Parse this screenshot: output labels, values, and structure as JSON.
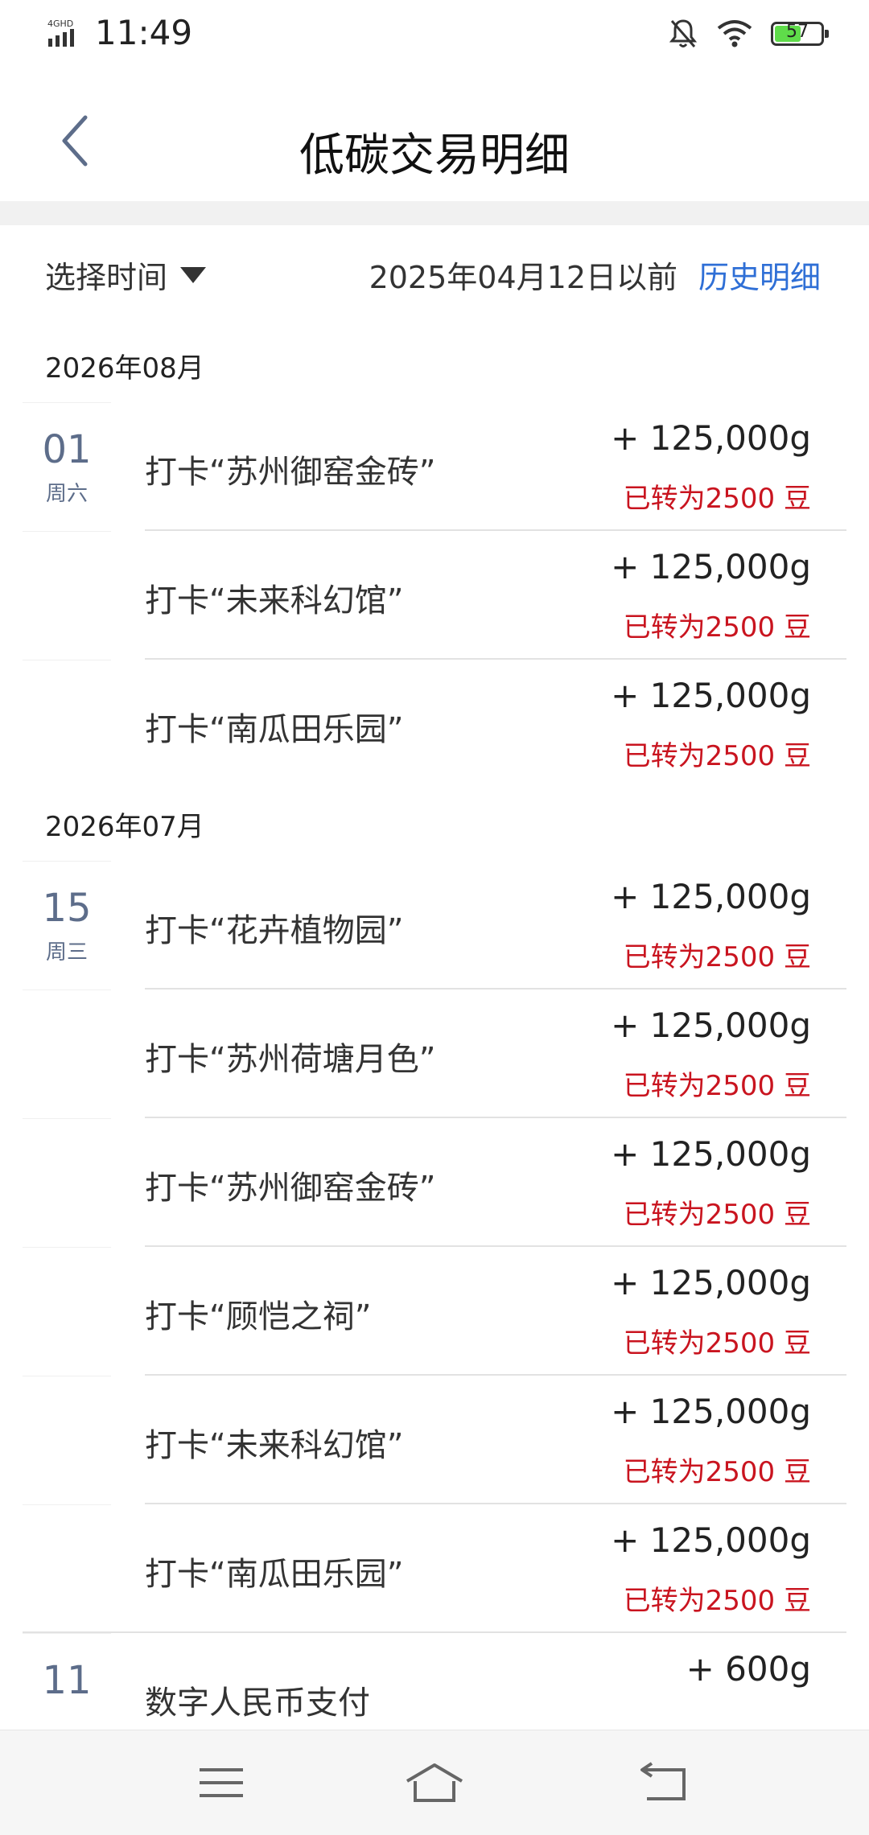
{
  "status_bar": {
    "network": "4GHD",
    "time": "11:49",
    "battery_percent": "57",
    "battery_level": 0.57,
    "icons": [
      "signal-icon",
      "mute-bell-icon",
      "wifi-icon",
      "battery-icon"
    ]
  },
  "header": {
    "title": "低碳交易明细",
    "back_icon": "back-arrow-icon"
  },
  "filter": {
    "select_label": "选择时间",
    "before_text": "2025年04月12日以前",
    "history_link": "历史明细"
  },
  "colors": {
    "accent_link": "#2f6fd6",
    "converted_red": "#c9141f",
    "date_blue_gray": "#5d6d8a"
  },
  "groups": [
    {
      "month": "2026年08月",
      "rows": [
        {
          "day": "01",
          "weekday": "周六",
          "title": "打卡“苏州御窑金砖”",
          "amount": "+ 125,000g",
          "converted": "已转为2500 豆"
        },
        {
          "day": "",
          "weekday": "",
          "title": "打卡“未来科幻馆”",
          "amount": "+ 125,000g",
          "converted": "已转为2500 豆"
        },
        {
          "day": "",
          "weekday": "",
          "title": "打卡“南瓜田乐园”",
          "amount": "+ 125,000g",
          "converted": "已转为2500 豆"
        }
      ]
    },
    {
      "month": "2026年07月",
      "rows": [
        {
          "day": "15",
          "weekday": "周三",
          "title": "打卡“花卉植物园”",
          "amount": "+ 125,000g",
          "converted": "已转为2500 豆"
        },
        {
          "day": "",
          "weekday": "",
          "title": "打卡“苏州荷塘月色”",
          "amount": "+ 125,000g",
          "converted": "已转为2500 豆"
        },
        {
          "day": "",
          "weekday": "",
          "title": "打卡“苏州御窑金砖”",
          "amount": "+ 125,000g",
          "converted": "已转为2500 豆"
        },
        {
          "day": "",
          "weekday": "",
          "title": "打卡“顾恺之祠”",
          "amount": "+ 125,000g",
          "converted": "已转为2500 豆"
        },
        {
          "day": "",
          "weekday": "",
          "title": "打卡“未来科幻馆”",
          "amount": "+ 125,000g",
          "converted": "已转为2500 豆"
        },
        {
          "day": "",
          "weekday": "",
          "title": "打卡“南瓜田乐园”",
          "amount": "+ 125,000g",
          "converted": "已转为2500 豆"
        },
        {
          "day": "11",
          "weekday": "",
          "title": "数字人民币支付",
          "amount": "+ 600g",
          "converted": ""
        }
      ]
    }
  ],
  "nav_bar": {
    "icons": [
      "menu-icon",
      "home-icon",
      "back-nav-icon"
    ]
  }
}
